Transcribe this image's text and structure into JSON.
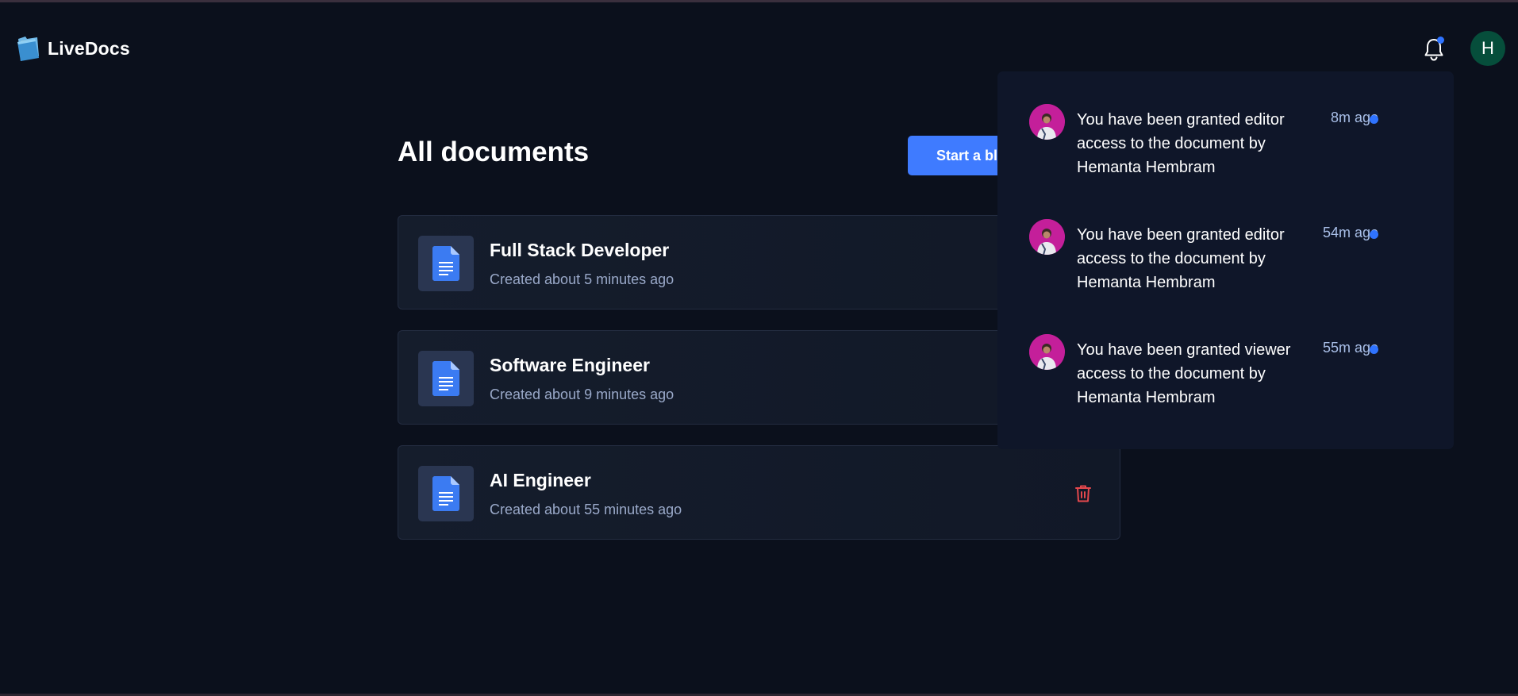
{
  "app": {
    "name": "LiveDocs"
  },
  "header": {
    "avatar_initial": "H"
  },
  "main": {
    "title": "All documents",
    "start_button_label": "Start a blank document"
  },
  "documents": [
    {
      "title": "Full Stack Developer",
      "created": "Created about 5 minutes ago"
    },
    {
      "title": "Software Engineer",
      "created": "Created about 9 minutes ago"
    },
    {
      "title": "AI Engineer",
      "created": "Created about 55 minutes ago"
    }
  ],
  "notifications": [
    {
      "message": "You have been granted editor access to the document by Hemanta Hembram",
      "time": "8m ago"
    },
    {
      "message": "You have been granted editor access to the document by Hemanta Hembram",
      "time": "54m ago"
    },
    {
      "message": "You have been granted viewer access to the document by Hemanta Hembram",
      "time": "55m ago"
    }
  ],
  "icons": {
    "logo": "folder-logo-icon",
    "notifications": "bell-icon",
    "document": "document-icon",
    "delete": "trash-icon",
    "add": "plus-icon"
  },
  "colors": {
    "background": "#0b101c",
    "accent": "#3f7bff",
    "unread_dot": "#2f73ff",
    "delete": "#e5484d",
    "avatar": "#064e3b",
    "panel": "#0f1629"
  }
}
